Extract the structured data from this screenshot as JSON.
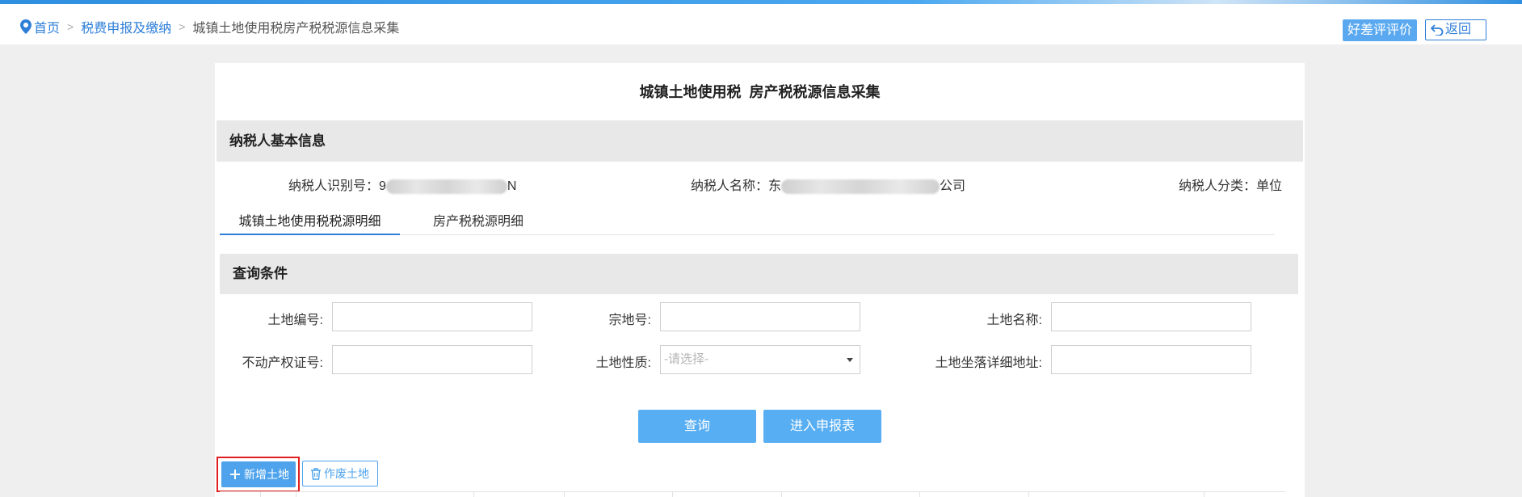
{
  "header": {
    "breadcrumb": {
      "home": "首页",
      "level2": "税费申报及缴纳",
      "current": "城镇土地使用税房产税税源信息采集"
    },
    "eval_button": "好差评评价",
    "back_button": "返回"
  },
  "panel": {
    "title": "城镇土地使用税  房产税税源信息采集",
    "taxpayer_section": "纳税人基本信息",
    "taxpayer": {
      "id_label": "纳税人识别号：",
      "id_prefix": "9",
      "id_suffix": "N",
      "name_label": "纳税人名称：",
      "name_prefix": "东",
      "name_suffix": "公司",
      "category_label": "纳税人分类：",
      "category_value": "单位"
    },
    "tabs": [
      {
        "label": "城镇土地使用税税源明细",
        "active": true
      },
      {
        "label": "房产税税源明细",
        "active": false
      }
    ],
    "query_section": "查询条件",
    "query": {
      "land_no_label": "土地编号:",
      "land_no_value": "",
      "parcel_no_label": "宗地号:",
      "parcel_no_value": "",
      "land_name_label": "土地名称:",
      "land_name_value": "",
      "cert_no_label": "不动产权证号:",
      "cert_no_value": "",
      "land_nature_label": "土地性质:",
      "land_nature_placeholder": "-请选择-",
      "address_label": "土地坐落详细地址:",
      "address_value": ""
    },
    "buttons": {
      "query": "查询",
      "enter_report": "进入申报表",
      "add_land": "新增土地",
      "void_land": "作废土地"
    }
  },
  "colors": {
    "primary": "#58aef3",
    "link": "#2f7fd8",
    "highlight_outline": "#e02020"
  }
}
